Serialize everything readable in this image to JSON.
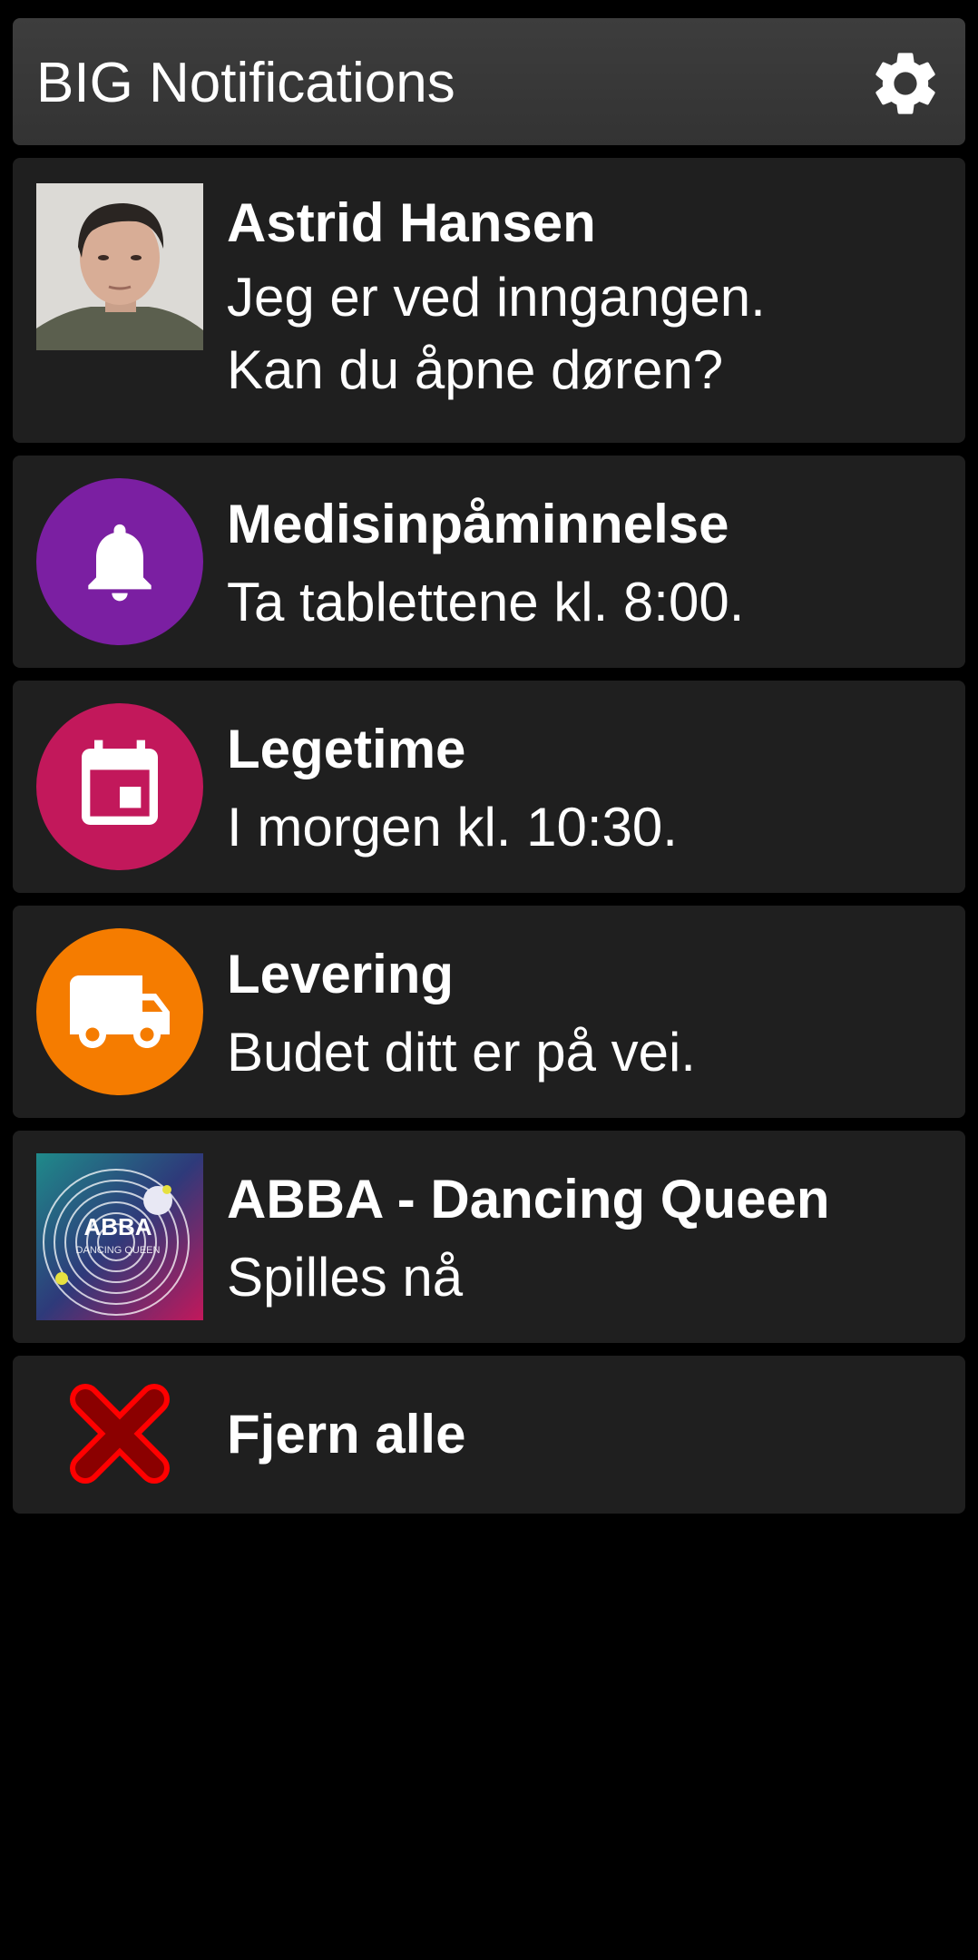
{
  "header": {
    "title": "BIG Notifications",
    "settings_icon": "gear-icon"
  },
  "notifications": [
    {
      "title": "Astrid Hansen",
      "body_lines": [
        "Jeg er ved inngangen.",
        "Kan du åpne døren?"
      ],
      "icon": "contact-photo",
      "icon_bg": "#d8d6d2"
    },
    {
      "title": "Medisinpåminnelse",
      "body_lines": [
        "Ta tablettene kl. 8:00."
      ],
      "icon": "bell-icon",
      "icon_bg": "#7b1fa2"
    },
    {
      "title": "Legetime",
      "body_lines": [
        "I morgen kl. 10:30."
      ],
      "icon": "calendar-icon",
      "icon_bg": "#c2185b"
    },
    {
      "title": "Levering",
      "body_lines": [
        "Budet ditt er på vei."
      ],
      "icon": "truck-icon",
      "icon_bg": "#f57c00"
    },
    {
      "title": "ABBA - Dancing Queen",
      "body_lines": [
        "Spilles nå"
      ],
      "icon": "album-art",
      "album_art_text": [
        "ABBA",
        "DANCING QUEEN"
      ],
      "icon_bg": "#3a2d6e"
    }
  ],
  "dismiss_all": {
    "label": "Fjern alle",
    "icon": "close-icon",
    "icon_color": "#ff0000"
  }
}
